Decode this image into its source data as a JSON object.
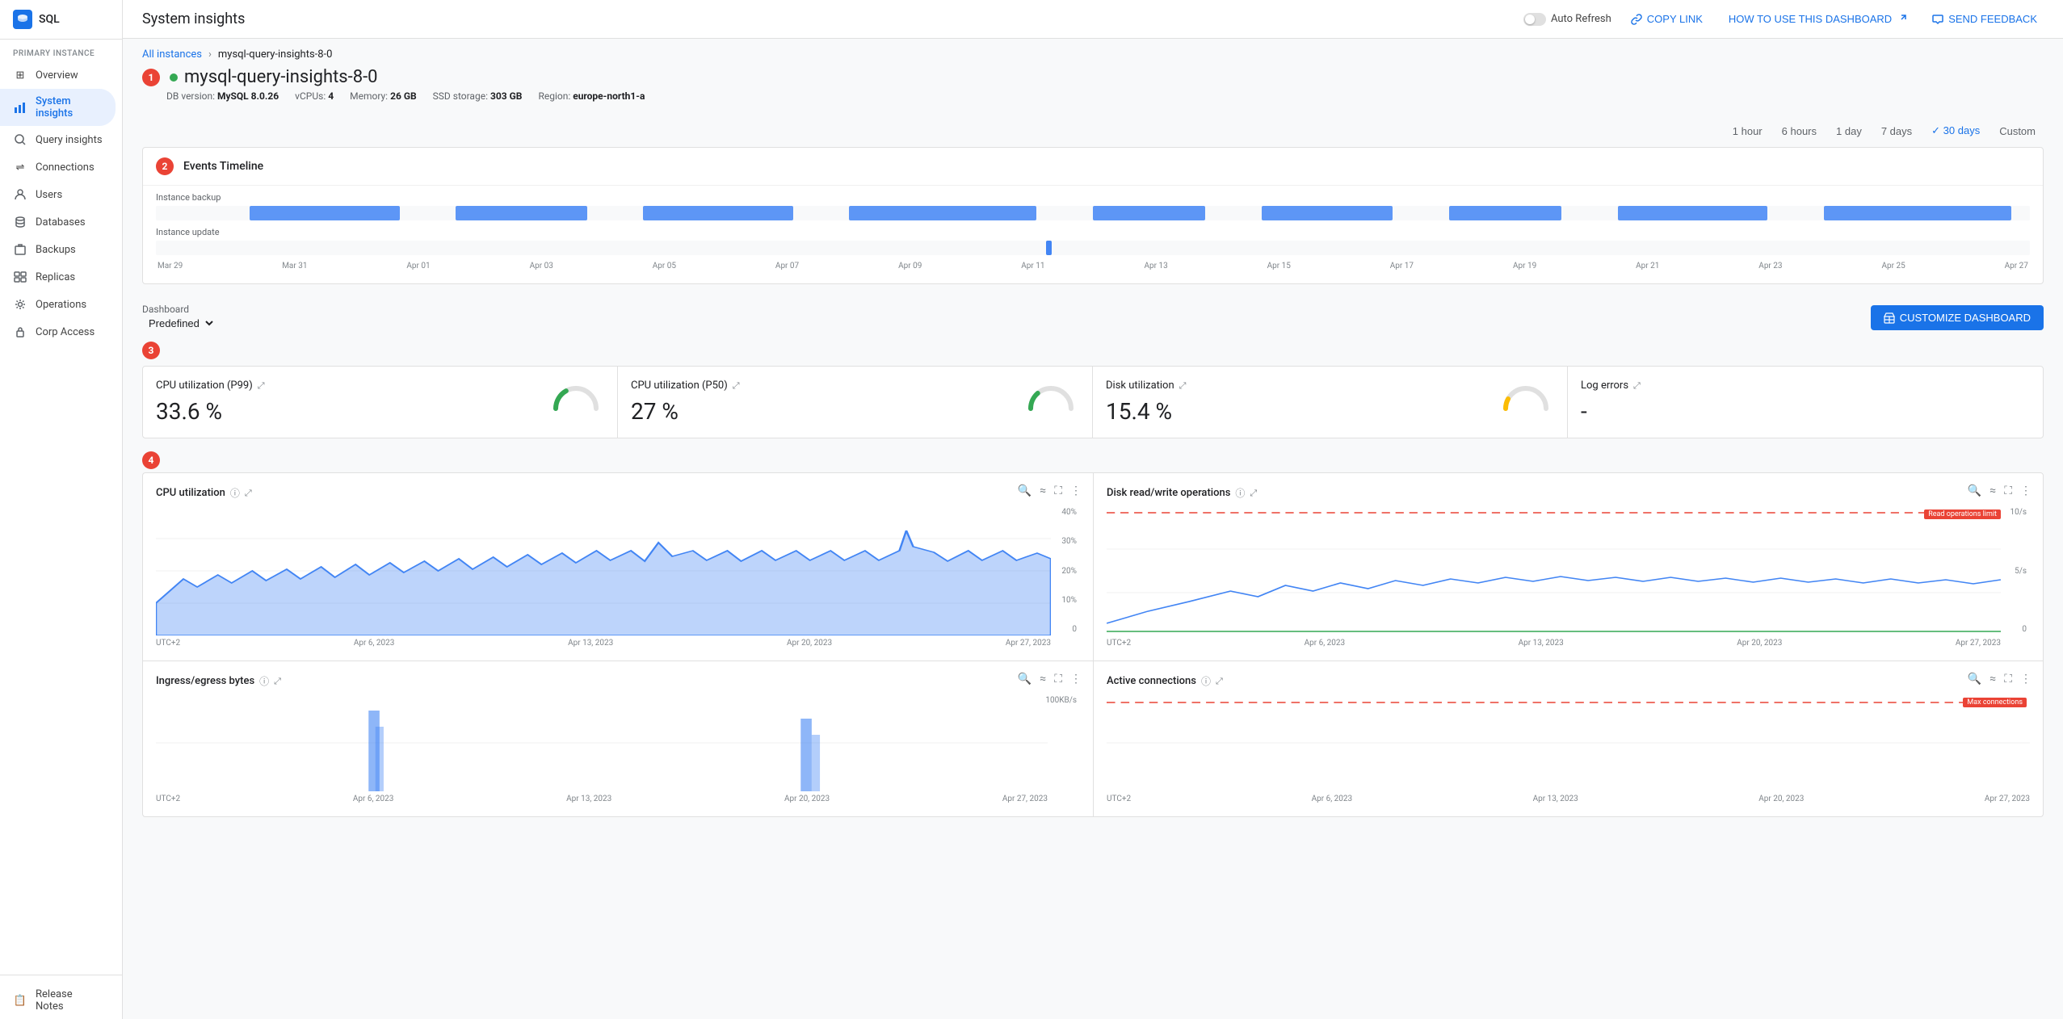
{
  "app": {
    "title": "SQL",
    "db_icon": "SQL"
  },
  "sidebar": {
    "section_label": "PRIMARY INSTANCE",
    "items": [
      {
        "id": "overview",
        "label": "Overview",
        "icon": "⊞",
        "active": false
      },
      {
        "id": "system-insights",
        "label": "System insights",
        "icon": "📊",
        "active": true
      },
      {
        "id": "query-insights",
        "label": "Query insights",
        "icon": "🔍",
        "active": false
      },
      {
        "id": "connections",
        "label": "Connections",
        "icon": "⇌",
        "active": false
      },
      {
        "id": "users",
        "label": "Users",
        "icon": "👤",
        "active": false
      },
      {
        "id": "databases",
        "label": "Databases",
        "icon": "🗄",
        "active": false
      },
      {
        "id": "backups",
        "label": "Backups",
        "icon": "💾",
        "active": false
      },
      {
        "id": "replicas",
        "label": "Replicas",
        "icon": "⎘",
        "active": false
      },
      {
        "id": "operations",
        "label": "Operations",
        "icon": "⚙",
        "active": false
      },
      {
        "id": "corp-access",
        "label": "Corp Access",
        "icon": "🔒",
        "active": false
      }
    ],
    "bottom_item": "Release Notes"
  },
  "topbar": {
    "title": "System insights",
    "auto_refresh": "Auto Refresh",
    "copy_link": "COPY LINK",
    "how_to": "HOW TO USE THIS DASHBOARD",
    "send_feedback": "SEND FEEDBACK"
  },
  "breadcrumb": {
    "all_instances": "All instances",
    "separator": ">",
    "current": "mysql-query-insights-8-0"
  },
  "instance": {
    "name": "mysql-query-insights-8-0",
    "status": "running",
    "db_version_label": "DB version:",
    "db_version": "MySQL 8.0.26",
    "vcpus_label": "vCPUs:",
    "vcpus": "4",
    "memory_label": "Memory:",
    "memory": "26 GB",
    "ssd_label": "SSD storage:",
    "ssd": "303 GB",
    "region_label": "Region:",
    "region": "europe-north1-a"
  },
  "time_range": {
    "options": [
      "1 hour",
      "6 hours",
      "1 day",
      "7 days",
      "30 days",
      "Custom"
    ],
    "active": "30 days"
  },
  "events_timeline": {
    "title": "Events Timeline",
    "row1_label": "Instance backup",
    "row2_label": "Instance update",
    "axis_labels": [
      "Mar 29",
      "Mar 31",
      "Apr 01",
      "Apr 03",
      "Apr 05",
      "Apr 07",
      "Apr 09",
      "Apr 11",
      "Apr 13",
      "Apr 15",
      "Apr 17",
      "Apr 19",
      "Apr 21",
      "Apr 23",
      "Apr 25",
      "Apr 27"
    ]
  },
  "dashboard_section": {
    "label": "Dashboard",
    "select_value": "Predefined",
    "customize_btn": "CUSTOMIZE DASHBOARD"
  },
  "metric_cards": [
    {
      "title": "CPU utilization (P99)",
      "value": "33.6 %",
      "gauge_pct": 33.6,
      "gauge_color": "#34a853"
    },
    {
      "title": "CPU utilization (P50)",
      "value": "27 %",
      "gauge_pct": 27,
      "gauge_color": "#34a853"
    },
    {
      "title": "Disk utilization",
      "value": "15.4 %",
      "gauge_pct": 15.4,
      "gauge_color": "#34a853"
    },
    {
      "title": "Log errors",
      "value": "-",
      "gauge_pct": 0,
      "gauge_color": "#e0e0e0"
    }
  ],
  "charts": {
    "cpu_util": {
      "title": "CPU utilization",
      "has_info": true,
      "y_labels": [
        "40%",
        "30%",
        "20%",
        "10%",
        "0"
      ],
      "x_labels": [
        "UTC+2",
        "Apr 6, 2023",
        "Apr 13, 2023",
        "Apr 20, 2023",
        "Apr 27, 2023"
      ]
    },
    "disk_rw": {
      "title": "Disk read/write operations",
      "has_info": true,
      "limit_label": "Read operations limit",
      "y_labels": [
        "10/s",
        "5/s",
        "0"
      ],
      "x_labels": [
        "UTC+2",
        "Apr 6, 2023",
        "Apr 13, 2023",
        "Apr 20, 2023",
        "Apr 27, 2023"
      ]
    },
    "ingress_egress": {
      "title": "Ingress/egress bytes",
      "has_info": true,
      "y_labels": [
        "100KB/s"
      ],
      "x_labels": [
        "UTC+2",
        "Apr 6, 2023",
        "Apr 13, 2023",
        "Apr 20, 2023",
        "Apr 27, 2023"
      ]
    },
    "active_conn": {
      "title": "Active connections",
      "has_info": true,
      "max_label": "Max connections",
      "y_labels": [],
      "x_labels": [
        "UTC+2",
        "Apr 6, 2023",
        "Apr 13, 2023",
        "Apr 20, 2023",
        "Apr 27, 2023"
      ]
    }
  }
}
